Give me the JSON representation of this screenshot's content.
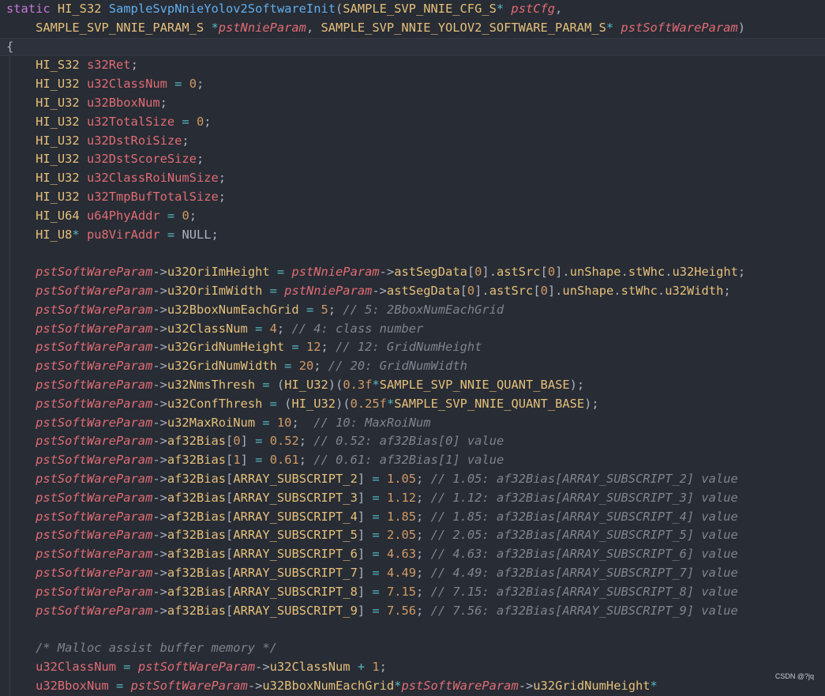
{
  "colors": {
    "background": "#282c34",
    "keyword": "#c678dd",
    "type": "#e5c07b",
    "function": "#61afef",
    "variable": "#e06c75",
    "operator": "#56b6c2",
    "number": "#d19a66",
    "comment": "#7f848e"
  },
  "editor": {
    "current_line_index": 2,
    "lines": [
      [
        [
          "kw",
          "static "
        ],
        [
          "type",
          "HI_S32 "
        ],
        [
          "fn",
          "SampleSvpNnieYolov2SoftwareInit"
        ],
        [
          "punc",
          "("
        ],
        [
          "type",
          "SAMPLE_SVP_NNIE_CFG_S"
        ],
        [
          "op",
          "* "
        ],
        [
          "param",
          "pstCfg"
        ],
        [
          "punc",
          ","
        ]
      ],
      [
        [
          "punc",
          "    "
        ],
        [
          "type",
          "SAMPLE_SVP_NNIE_PARAM_S "
        ],
        [
          "op",
          "*"
        ],
        [
          "param",
          "pstNnieParam"
        ],
        [
          "punc",
          ", "
        ],
        [
          "type",
          "SAMPLE_SVP_NNIE_YOLOV2_SOFTWARE_PARAM_S"
        ],
        [
          "op",
          "* "
        ],
        [
          "param",
          "pstSoftWareParam"
        ],
        [
          "punc",
          ")"
        ]
      ],
      [
        [
          "punc",
          "{"
        ]
      ],
      [
        [
          "punc",
          "    "
        ],
        [
          "type",
          "HI_S32 "
        ],
        [
          "var",
          "s32Ret"
        ],
        [
          "punc",
          ";"
        ]
      ],
      [
        [
          "punc",
          "    "
        ],
        [
          "type",
          "HI_U32 "
        ],
        [
          "var",
          "u32ClassNum "
        ],
        [
          "op",
          "= "
        ],
        [
          "num",
          "0"
        ],
        [
          "punc",
          ";"
        ]
      ],
      [
        [
          "punc",
          "    "
        ],
        [
          "type",
          "HI_U32 "
        ],
        [
          "var",
          "u32BboxNum"
        ],
        [
          "punc",
          ";"
        ]
      ],
      [
        [
          "punc",
          "    "
        ],
        [
          "type",
          "HI_U32 "
        ],
        [
          "var",
          "u32TotalSize "
        ],
        [
          "op",
          "= "
        ],
        [
          "num",
          "0"
        ],
        [
          "punc",
          ";"
        ]
      ],
      [
        [
          "punc",
          "    "
        ],
        [
          "type",
          "HI_U32 "
        ],
        [
          "var",
          "u32DstRoiSize"
        ],
        [
          "punc",
          ";"
        ]
      ],
      [
        [
          "punc",
          "    "
        ],
        [
          "type",
          "HI_U32 "
        ],
        [
          "var",
          "u32DstScoreSize"
        ],
        [
          "punc",
          ";"
        ]
      ],
      [
        [
          "punc",
          "    "
        ],
        [
          "type",
          "HI_U32 "
        ],
        [
          "var",
          "u32ClassRoiNumSize"
        ],
        [
          "punc",
          ";"
        ]
      ],
      [
        [
          "punc",
          "    "
        ],
        [
          "type",
          "HI_U32 "
        ],
        [
          "var",
          "u32TmpBufTotalSize"
        ],
        [
          "punc",
          ";"
        ]
      ],
      [
        [
          "punc",
          "    "
        ],
        [
          "type",
          "HI_U64 "
        ],
        [
          "var",
          "u64PhyAddr "
        ],
        [
          "op",
          "= "
        ],
        [
          "num",
          "0"
        ],
        [
          "punc",
          ";"
        ]
      ],
      [
        [
          "punc",
          "    "
        ],
        [
          "type",
          "HI_U8"
        ],
        [
          "op",
          "* "
        ],
        [
          "var",
          "pu8VirAddr "
        ],
        [
          "op",
          "= "
        ],
        [
          "null",
          "NULL"
        ],
        [
          "punc",
          ";"
        ]
      ],
      [],
      [
        [
          "punc",
          "    "
        ],
        [
          "param",
          "pstSoftWareParam"
        ],
        [
          "punc",
          "->"
        ],
        [
          "mem",
          "u32OriImHeight "
        ],
        [
          "op",
          "= "
        ],
        [
          "param",
          "pstNnieParam"
        ],
        [
          "punc",
          "->"
        ],
        [
          "mem",
          "astSegData"
        ],
        [
          "punc",
          "["
        ],
        [
          "num",
          "0"
        ],
        [
          "punc",
          "]."
        ],
        [
          "mem",
          "astSrc"
        ],
        [
          "punc",
          "["
        ],
        [
          "num",
          "0"
        ],
        [
          "punc",
          "]."
        ],
        [
          "mem",
          "unShape"
        ],
        [
          "punc",
          "."
        ],
        [
          "mem",
          "stWhc"
        ],
        [
          "punc",
          "."
        ],
        [
          "mem",
          "u32Height"
        ],
        [
          "punc",
          ";"
        ]
      ],
      [
        [
          "punc",
          "    "
        ],
        [
          "param",
          "pstSoftWareParam"
        ],
        [
          "punc",
          "->"
        ],
        [
          "mem",
          "u32OriImWidth "
        ],
        [
          "op",
          "= "
        ],
        [
          "param",
          "pstNnieParam"
        ],
        [
          "punc",
          "->"
        ],
        [
          "mem",
          "astSegData"
        ],
        [
          "punc",
          "["
        ],
        [
          "num",
          "0"
        ],
        [
          "punc",
          "]."
        ],
        [
          "mem",
          "astSrc"
        ],
        [
          "punc",
          "["
        ],
        [
          "num",
          "0"
        ],
        [
          "punc",
          "]."
        ],
        [
          "mem",
          "unShape"
        ],
        [
          "punc",
          "."
        ],
        [
          "mem",
          "stWhc"
        ],
        [
          "punc",
          "."
        ],
        [
          "mem",
          "u32Width"
        ],
        [
          "punc",
          ";"
        ]
      ],
      [
        [
          "punc",
          "    "
        ],
        [
          "param",
          "pstSoftWareParam"
        ],
        [
          "punc",
          "->"
        ],
        [
          "mem",
          "u32BboxNumEachGrid "
        ],
        [
          "op",
          "= "
        ],
        [
          "num",
          "5"
        ],
        [
          "punc",
          "; "
        ],
        [
          "cm",
          "// 5: 2BboxNumEachGrid"
        ]
      ],
      [
        [
          "punc",
          "    "
        ],
        [
          "param",
          "pstSoftWareParam"
        ],
        [
          "punc",
          "->"
        ],
        [
          "mem",
          "u32ClassNum "
        ],
        [
          "op",
          "= "
        ],
        [
          "num",
          "4"
        ],
        [
          "punc",
          "; "
        ],
        [
          "cm",
          "// 4: class number"
        ]
      ],
      [
        [
          "punc",
          "    "
        ],
        [
          "param",
          "pstSoftWareParam"
        ],
        [
          "punc",
          "->"
        ],
        [
          "mem",
          "u32GridNumHeight "
        ],
        [
          "op",
          "= "
        ],
        [
          "num",
          "12"
        ],
        [
          "punc",
          "; "
        ],
        [
          "cm",
          "// 12: GridNumHeight"
        ]
      ],
      [
        [
          "punc",
          "    "
        ],
        [
          "param",
          "pstSoftWareParam"
        ],
        [
          "punc",
          "->"
        ],
        [
          "mem",
          "u32GridNumWidth "
        ],
        [
          "op",
          "= "
        ],
        [
          "num",
          "20"
        ],
        [
          "punc",
          "; "
        ],
        [
          "cm",
          "// 20: GridNumWidth"
        ]
      ],
      [
        [
          "punc",
          "    "
        ],
        [
          "param",
          "pstSoftWareParam"
        ],
        [
          "punc",
          "->"
        ],
        [
          "mem",
          "u32NmsThresh "
        ],
        [
          "op",
          "= "
        ],
        [
          "punc",
          "("
        ],
        [
          "type",
          "HI_U32"
        ],
        [
          "punc",
          ")("
        ],
        [
          "num",
          "0.3f"
        ],
        [
          "op",
          "*"
        ],
        [
          "macro",
          "SAMPLE_SVP_NNIE_QUANT_BASE"
        ],
        [
          "punc",
          ");"
        ]
      ],
      [
        [
          "punc",
          "    "
        ],
        [
          "param",
          "pstSoftWareParam"
        ],
        [
          "punc",
          "->"
        ],
        [
          "mem",
          "u32ConfThresh "
        ],
        [
          "op",
          "= "
        ],
        [
          "punc",
          "("
        ],
        [
          "type",
          "HI_U32"
        ],
        [
          "punc",
          ")("
        ],
        [
          "num",
          "0.25f"
        ],
        [
          "op",
          "*"
        ],
        [
          "macro",
          "SAMPLE_SVP_NNIE_QUANT_BASE"
        ],
        [
          "punc",
          ");"
        ]
      ],
      [
        [
          "punc",
          "    "
        ],
        [
          "param",
          "pstSoftWareParam"
        ],
        [
          "punc",
          "->"
        ],
        [
          "mem",
          "u32MaxRoiNum "
        ],
        [
          "op",
          "= "
        ],
        [
          "num",
          "10"
        ],
        [
          "punc",
          ";  "
        ],
        [
          "cm",
          "// 10: MaxRoiNum"
        ]
      ],
      [
        [
          "punc",
          "    "
        ],
        [
          "param",
          "pstSoftWareParam"
        ],
        [
          "punc",
          "->"
        ],
        [
          "mem",
          "af32Bias"
        ],
        [
          "punc",
          "["
        ],
        [
          "num",
          "0"
        ],
        [
          "punc",
          "] "
        ],
        [
          "op",
          "= "
        ],
        [
          "num",
          "0.52"
        ],
        [
          "punc",
          "; "
        ],
        [
          "cm",
          "// 0.52: af32Bias[0] value"
        ]
      ],
      [
        [
          "punc",
          "    "
        ],
        [
          "param",
          "pstSoftWareParam"
        ],
        [
          "punc",
          "->"
        ],
        [
          "mem",
          "af32Bias"
        ],
        [
          "punc",
          "["
        ],
        [
          "num",
          "1"
        ],
        [
          "punc",
          "] "
        ],
        [
          "op",
          "= "
        ],
        [
          "num",
          "0.61"
        ],
        [
          "punc",
          "; "
        ],
        [
          "cm",
          "// 0.61: af32Bias[1] value"
        ]
      ],
      [
        [
          "punc",
          "    "
        ],
        [
          "param",
          "pstSoftWareParam"
        ],
        [
          "punc",
          "->"
        ],
        [
          "mem",
          "af32Bias"
        ],
        [
          "punc",
          "["
        ],
        [
          "macro",
          "ARRAY_SUBSCRIPT_2"
        ],
        [
          "punc",
          "] "
        ],
        [
          "op",
          "= "
        ],
        [
          "num",
          "1.05"
        ],
        [
          "punc",
          "; "
        ],
        [
          "cm",
          "// 1.05: af32Bias[ARRAY_SUBSCRIPT_2] value"
        ]
      ],
      [
        [
          "punc",
          "    "
        ],
        [
          "param",
          "pstSoftWareParam"
        ],
        [
          "punc",
          "->"
        ],
        [
          "mem",
          "af32Bias"
        ],
        [
          "punc",
          "["
        ],
        [
          "macro",
          "ARRAY_SUBSCRIPT_3"
        ],
        [
          "punc",
          "] "
        ],
        [
          "op",
          "= "
        ],
        [
          "num",
          "1.12"
        ],
        [
          "punc",
          "; "
        ],
        [
          "cm",
          "// 1.12: af32Bias[ARRAY_SUBSCRIPT_3] value"
        ]
      ],
      [
        [
          "punc",
          "    "
        ],
        [
          "param",
          "pstSoftWareParam"
        ],
        [
          "punc",
          "->"
        ],
        [
          "mem",
          "af32Bias"
        ],
        [
          "punc",
          "["
        ],
        [
          "macro",
          "ARRAY_SUBSCRIPT_4"
        ],
        [
          "punc",
          "] "
        ],
        [
          "op",
          "= "
        ],
        [
          "num",
          "1.85"
        ],
        [
          "punc",
          "; "
        ],
        [
          "cm",
          "// 1.85: af32Bias[ARRAY_SUBSCRIPT_4] value"
        ]
      ],
      [
        [
          "punc",
          "    "
        ],
        [
          "param",
          "pstSoftWareParam"
        ],
        [
          "punc",
          "->"
        ],
        [
          "mem",
          "af32Bias"
        ],
        [
          "punc",
          "["
        ],
        [
          "macro",
          "ARRAY_SUBSCRIPT_5"
        ],
        [
          "punc",
          "] "
        ],
        [
          "op",
          "= "
        ],
        [
          "num",
          "2.05"
        ],
        [
          "punc",
          "; "
        ],
        [
          "cm",
          "// 2.05: af32Bias[ARRAY_SUBSCRIPT_5] value"
        ]
      ],
      [
        [
          "punc",
          "    "
        ],
        [
          "param",
          "pstSoftWareParam"
        ],
        [
          "punc",
          "->"
        ],
        [
          "mem",
          "af32Bias"
        ],
        [
          "punc",
          "["
        ],
        [
          "macro",
          "ARRAY_SUBSCRIPT_6"
        ],
        [
          "punc",
          "] "
        ],
        [
          "op",
          "= "
        ],
        [
          "num",
          "4.63"
        ],
        [
          "punc",
          "; "
        ],
        [
          "cm",
          "// 4.63: af32Bias[ARRAY_SUBSCRIPT_6] value"
        ]
      ],
      [
        [
          "punc",
          "    "
        ],
        [
          "param",
          "pstSoftWareParam"
        ],
        [
          "punc",
          "->"
        ],
        [
          "mem",
          "af32Bias"
        ],
        [
          "punc",
          "["
        ],
        [
          "macro",
          "ARRAY_SUBSCRIPT_7"
        ],
        [
          "punc",
          "] "
        ],
        [
          "op",
          "= "
        ],
        [
          "num",
          "4.49"
        ],
        [
          "punc",
          "; "
        ],
        [
          "cm",
          "// 4.49: af32Bias[ARRAY_SUBSCRIPT_7] value"
        ]
      ],
      [
        [
          "punc",
          "    "
        ],
        [
          "param",
          "pstSoftWareParam"
        ],
        [
          "punc",
          "->"
        ],
        [
          "mem",
          "af32Bias"
        ],
        [
          "punc",
          "["
        ],
        [
          "macro",
          "ARRAY_SUBSCRIPT_8"
        ],
        [
          "punc",
          "] "
        ],
        [
          "op",
          "= "
        ],
        [
          "num",
          "7.15"
        ],
        [
          "punc",
          "; "
        ],
        [
          "cm",
          "// 7.15: af32Bias[ARRAY_SUBSCRIPT_8] value"
        ]
      ],
      [
        [
          "punc",
          "    "
        ],
        [
          "param",
          "pstSoftWareParam"
        ],
        [
          "punc",
          "->"
        ],
        [
          "mem",
          "af32Bias"
        ],
        [
          "punc",
          "["
        ],
        [
          "macro",
          "ARRAY_SUBSCRIPT_9"
        ],
        [
          "punc",
          "] "
        ],
        [
          "op",
          "= "
        ],
        [
          "num",
          "7.56"
        ],
        [
          "punc",
          "; "
        ],
        [
          "cm",
          "// 7.56: af32Bias[ARRAY_SUBSCRIPT_9] value"
        ]
      ],
      [],
      [
        [
          "punc",
          "    "
        ],
        [
          "cm",
          "/* Malloc assist buffer memory */"
        ]
      ],
      [
        [
          "punc",
          "    "
        ],
        [
          "var",
          "u32ClassNum "
        ],
        [
          "op",
          "= "
        ],
        [
          "param",
          "pstSoftWareParam"
        ],
        [
          "punc",
          "->"
        ],
        [
          "mem",
          "u32ClassNum "
        ],
        [
          "op",
          "+ "
        ],
        [
          "num",
          "1"
        ],
        [
          "punc",
          ";"
        ]
      ],
      [
        [
          "punc",
          "    "
        ],
        [
          "var",
          "u32BboxNum "
        ],
        [
          "op",
          "= "
        ],
        [
          "param",
          "pstSoftWareParam"
        ],
        [
          "punc",
          "->"
        ],
        [
          "mem",
          "u32BboxNumEachGrid"
        ],
        [
          "op",
          "*"
        ],
        [
          "param",
          "pstSoftWareParam"
        ],
        [
          "punc",
          "->"
        ],
        [
          "mem",
          "u32GridNumHeight"
        ],
        [
          "op",
          "*"
        ]
      ]
    ]
  },
  "watermark": "CSDN @?jq"
}
